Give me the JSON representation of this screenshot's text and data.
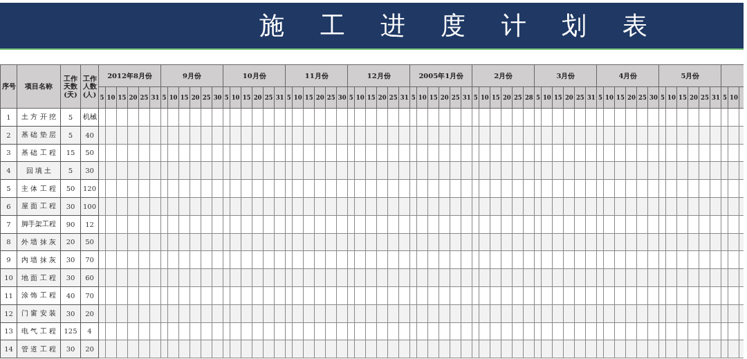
{
  "title": "施 工 进 度 计 划 表",
  "table": {
    "columns": [
      {
        "label": "序号"
      },
      {
        "label": "项目名称"
      },
      {
        "label": "工作天数(天)"
      },
      {
        "label": "工作人数(人)"
      }
    ],
    "months": [
      {
        "label": "2012年8月份",
        "days": [
          "5",
          "10",
          "15",
          "20",
          "25",
          "31"
        ]
      },
      {
        "label": "9月份",
        "days": [
          "5",
          "10",
          "15",
          "20",
          "25",
          "30"
        ]
      },
      {
        "label": "10月份",
        "days": [
          "5",
          "10",
          "15",
          "20",
          "25",
          "31"
        ]
      },
      {
        "label": "11月份",
        "days": [
          "5",
          "10",
          "15",
          "20",
          "25",
          "30"
        ]
      },
      {
        "label": "12月份",
        "days": [
          "5",
          "10",
          "15",
          "20",
          "25",
          "31"
        ]
      },
      {
        "label": "2005年1月份",
        "days": [
          "5",
          "10",
          "15",
          "20",
          "25",
          "31"
        ]
      },
      {
        "label": "2月份",
        "days": [
          "5",
          "10",
          "15",
          "20",
          "25",
          "28"
        ]
      },
      {
        "label": "3月份",
        "days": [
          "5",
          "10",
          "15",
          "20",
          "25",
          "31"
        ]
      },
      {
        "label": "4月份",
        "days": [
          "5",
          "10",
          "15",
          "20",
          "25",
          "30"
        ]
      },
      {
        "label": "5月份",
        "days": [
          "5",
          "10",
          "15",
          "20",
          "25",
          "31"
        ]
      },
      {
        "days": [
          "5",
          "10"
        ]
      }
    ],
    "rows": [
      {
        "no": "1",
        "name": "土 方 开 挖",
        "days": "5",
        "workers": "机械"
      },
      {
        "no": "2",
        "name": "基 础 垫 层",
        "days": "5",
        "workers": "40"
      },
      {
        "no": "3",
        "name": "基 础 工 程",
        "days": "15",
        "workers": "50"
      },
      {
        "no": "4",
        "name": "回  填  土",
        "days": "5",
        "workers": "30"
      },
      {
        "no": "5",
        "name": "主 体 工 程",
        "days": "50",
        "workers": "120"
      },
      {
        "no": "6",
        "name": "屋 面 工 程",
        "days": "30",
        "workers": "100"
      },
      {
        "no": "7",
        "name": "脚手架工程",
        "days": "90",
        "workers": "12"
      },
      {
        "no": "8",
        "name": "外 墙 抹 灰",
        "days": "20",
        "workers": "50"
      },
      {
        "no": "9",
        "name": "内 墙 抹 灰",
        "days": "30",
        "workers": "70"
      },
      {
        "no": "10",
        "name": "地 面 工 程",
        "days": "30",
        "workers": "60"
      },
      {
        "no": "11",
        "name": "涂 饰 工 程",
        "days": "40",
        "workers": "70"
      },
      {
        "no": "12",
        "name": "门 窗 安 装",
        "days": "30",
        "workers": "20"
      },
      {
        "no": "13",
        "name": "电 气 工 程",
        "days": "125",
        "workers": "4"
      },
      {
        "no": "14",
        "name": "管 道 工 程",
        "days": "30",
        "workers": "20"
      }
    ]
  }
}
